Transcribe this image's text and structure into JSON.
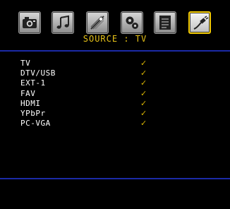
{
  "menu": {
    "title": "SOURCE : TV",
    "icons": [
      {
        "name": "picture"
      },
      {
        "name": "sound"
      },
      {
        "name": "feature"
      },
      {
        "name": "setup"
      },
      {
        "name": "list"
      },
      {
        "name": "source",
        "active": true
      }
    ]
  },
  "sources": [
    {
      "label": "TV",
      "mark": "✓"
    },
    {
      "label": "DTV/USB",
      "mark": "✓"
    },
    {
      "label": "EXT-1",
      "mark": "✓"
    },
    {
      "label": "FAV",
      "mark": "✓"
    },
    {
      "label": "HDMI",
      "mark": "✓"
    },
    {
      "label": "YPbPr",
      "mark": "✓"
    },
    {
      "label": "PC-VGA",
      "mark": "✓"
    }
  ],
  "colors": {
    "accent": "#e8c318",
    "rule": "#1b2aa6",
    "text": "#ffffff",
    "background": "#000000"
  }
}
